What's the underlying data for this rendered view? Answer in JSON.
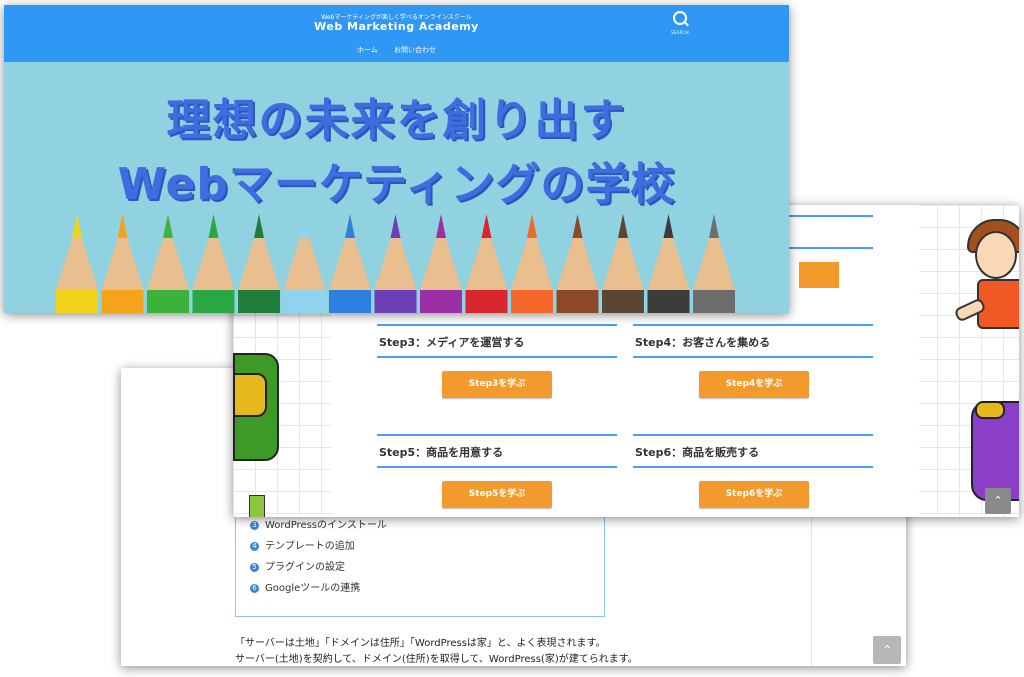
{
  "site": {
    "tagline": "Webマーケティングが楽しく学べるオンラインスクール",
    "title": "Web Marketing Academy",
    "search_label": "SEARCH",
    "nav": [
      "ホーム",
      "お問い合わせ"
    ]
  },
  "hero": {
    "line1": "理想の未来を創り出す",
    "line2": "Webマーケティングの学校",
    "pencil_colors": [
      "#f3d21a",
      "#f7a21b",
      "#3bb33a",
      "#29a846",
      "#1f7e3c",
      "#8fd3ef",
      "#2d7fe0",
      "#6b3fb5",
      "#9b2fa6",
      "#d7262e",
      "#f4672b",
      "#8a4a2a",
      "#5b4636",
      "#3b3b3b",
      "#6d6d6d"
    ]
  },
  "steps": [
    {
      "heading": "Step3：メディアを運営する",
      "button": "Step3を学ぶ"
    },
    {
      "heading": "Step4：お客さんを集める",
      "button": "Step4を学ぶ"
    },
    {
      "heading": "Step5：商品を用意する",
      "button": "Step5を学ぶ"
    },
    {
      "heading": "Step6：商品を販売する",
      "button": "Step6を学ぶ"
    }
  ],
  "scroll_top_icon": "chevron-up-icon",
  "article": {
    "toc": [
      {
        "num": "3",
        "label": "WordPressのインストール"
      },
      {
        "num": "4",
        "label": "テンプレートの追加"
      },
      {
        "num": "5",
        "label": "プラグインの設定"
      },
      {
        "num": "6",
        "label": "Googleツールの連携"
      }
    ],
    "paragraph1": "「サーバーは土地」「ドメインは住所」「WordPressは家」と、よく表現されます。",
    "paragraph2": "サーバー(土地)を契約して、ドメイン(住所)を取得して、WordPress(家)が建てられます。"
  },
  "colors": {
    "header_blue": "#2f97f4",
    "hero_sky": "#90d2df",
    "headline_blue": "#3f6de0",
    "step_rule": "#4a9ef0",
    "button_orange": "#f29b2c",
    "toc_border": "#8ec5ea"
  }
}
